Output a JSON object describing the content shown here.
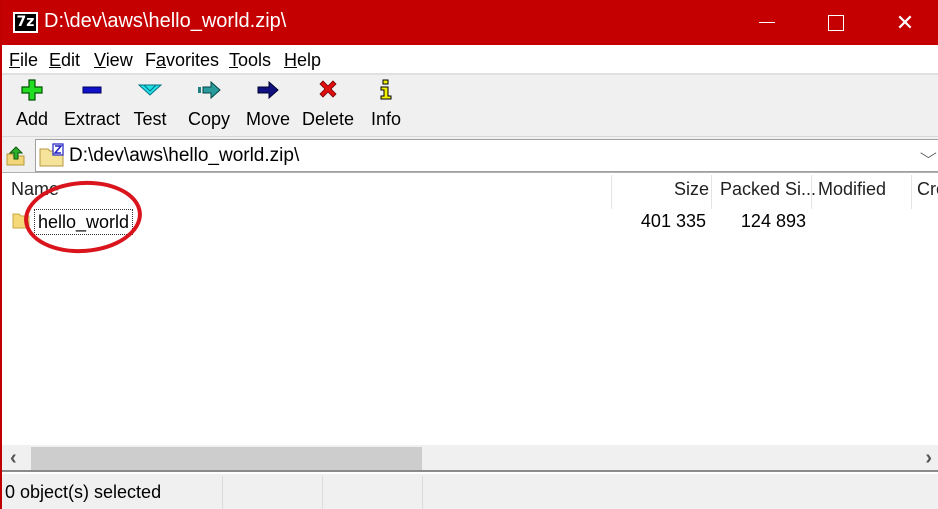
{
  "window": {
    "title": "D:\\dev\\aws\\hello_world.zip\\",
    "app_icon_label": "7z",
    "controls": {
      "minimize": "minimize-icon",
      "maximize": "maximize-icon",
      "close": "close-icon"
    },
    "accent_color": "#c40000"
  },
  "menu": [
    {
      "label": "File",
      "accel": "F",
      "rest": "ile"
    },
    {
      "label": "Edit",
      "accel": "E",
      "rest": "dit"
    },
    {
      "label": "View",
      "accel": "V",
      "rest": "iew"
    },
    {
      "label": "Favorites",
      "pre": "F",
      "accel": "a",
      "rest": "vorites"
    },
    {
      "label": "Tools",
      "accel": "T",
      "rest": "ools"
    },
    {
      "label": "Help",
      "accel": "H",
      "rest": "elp"
    }
  ],
  "toolbar": [
    {
      "label": "Add",
      "icon": "add-icon"
    },
    {
      "label": "Extract",
      "icon": "extract-icon"
    },
    {
      "label": "Test",
      "icon": "test-icon"
    },
    {
      "label": "Copy",
      "icon": "copy-icon"
    },
    {
      "label": "Move",
      "icon": "move-icon"
    },
    {
      "label": "Delete",
      "icon": "delete-icon"
    },
    {
      "label": "Info",
      "icon": "info-icon"
    }
  ],
  "address": {
    "path": "D:\\dev\\aws\\hello_world.zip\\",
    "dropdown_glyph": "⌵"
  },
  "list": {
    "columns": [
      "Name",
      "Size",
      "Packed Si...",
      "Modified",
      "Cre"
    ],
    "rows": [
      {
        "name": "hello_world",
        "size": "401 335",
        "packed_size": "124 893",
        "modified": "",
        "created": ""
      }
    ],
    "annotation": "red-circle-highlight"
  },
  "scrollbar": {
    "left": "‹",
    "right": "›"
  },
  "status": {
    "selected": "0 object(s) selected"
  }
}
